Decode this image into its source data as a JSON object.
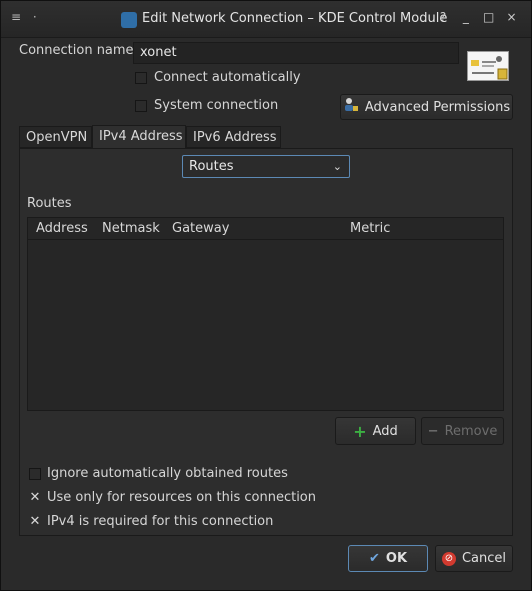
{
  "window": {
    "title": "Edit Network Connection – KDE Control Module",
    "left_controls": [
      "≡",
      "·"
    ],
    "right_controls": [
      "?",
      "_",
      "□",
      "×"
    ]
  },
  "connection": {
    "name_label": "Connection name:",
    "name_value": "xonet",
    "connect_auto_label": "Connect automatically",
    "system_label": "System connection",
    "advanced_permissions_label": "Advanced Permissions"
  },
  "tabs": [
    "OpenVPN",
    "IPv4 Address",
    "IPv6 Address"
  ],
  "routes_select": {
    "value": "Routes"
  },
  "routes": {
    "label": "Routes",
    "columns": [
      "Address",
      "Netmask",
      "Gateway",
      "Metric"
    ],
    "rows": [],
    "add_label": "Add",
    "remove_label": "Remove"
  },
  "options": {
    "ignore_routes_label": "Ignore automatically obtained routes",
    "only_resources_label": "Use only for resources on this connection",
    "ipv4_required_label": "IPv4 is required for this connection"
  },
  "footer": {
    "ok_label": "OK",
    "cancel_label": "Cancel"
  },
  "colors": {
    "accent": "#5c89b4",
    "add_green": "#3cb043",
    "cancel_red": "#d23a2f"
  }
}
